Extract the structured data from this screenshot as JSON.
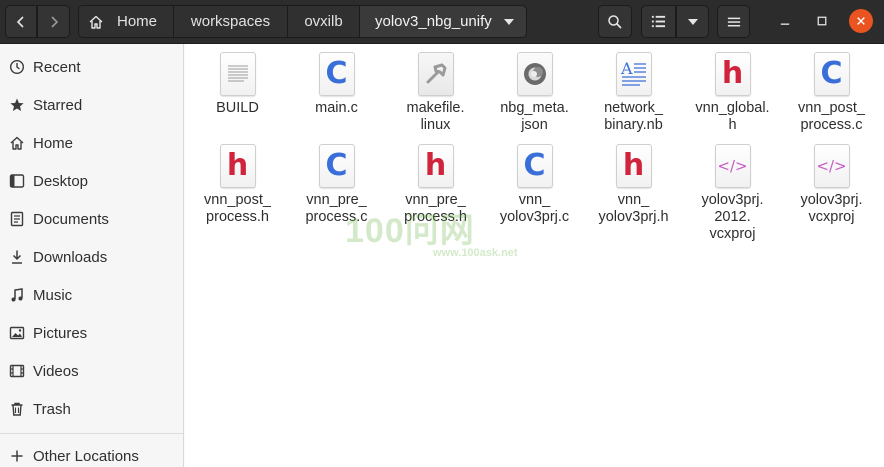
{
  "header": {
    "breadcrumbs": [
      "Home",
      "workspaces",
      "ovxilb",
      "yolov3_nbg_unify"
    ]
  },
  "sidebar": {
    "items": [
      {
        "label": "Recent",
        "icon": "clock-icon"
      },
      {
        "label": "Starred",
        "icon": "star-icon"
      },
      {
        "label": "Home",
        "icon": "home-icon"
      },
      {
        "label": "Desktop",
        "icon": "desktop-icon"
      },
      {
        "label": "Documents",
        "icon": "documents-icon"
      },
      {
        "label": "Downloads",
        "icon": "download-icon"
      },
      {
        "label": "Music",
        "icon": "music-icon"
      },
      {
        "label": "Pictures",
        "icon": "pictures-icon"
      },
      {
        "label": "Videos",
        "icon": "videos-icon"
      },
      {
        "label": "Trash",
        "icon": "trash-icon"
      }
    ],
    "other_locations": "Other Locations"
  },
  "files": [
    {
      "name": "BUILD",
      "type": "text"
    },
    {
      "name": "main.c",
      "type": "c"
    },
    {
      "name": "makefile.\nlinux",
      "type": "makefile"
    },
    {
      "name": "nbg_meta.\njson",
      "type": "json"
    },
    {
      "name": "network_\nbinary.nb",
      "type": "document"
    },
    {
      "name": "vnn_global.\nh",
      "type": "h"
    },
    {
      "name": "vnn_post_\nprocess.c",
      "type": "c"
    },
    {
      "name": "vnn_post_\nprocess.h",
      "type": "h"
    },
    {
      "name": "vnn_pre_\nprocess.c",
      "type": "c"
    },
    {
      "name": "vnn_pre_\nprocess.h",
      "type": "h"
    },
    {
      "name": "vnn_\nyolov3prj.c",
      "type": "c"
    },
    {
      "name": "vnn_\nyolov3prj.h",
      "type": "h"
    },
    {
      "name": "yolov3prj.\n2012.\nvcxproj",
      "type": "xml"
    },
    {
      "name": "yolov3prj.\nvcxproj",
      "type": "xml"
    }
  ],
  "icon_glyphs": {
    "c": "C",
    "h": "h",
    "xml": "</>",
    "document": "A"
  },
  "watermark": {
    "big": "100问网",
    "small": "www.100ask.net"
  },
  "colors": {
    "accent_close": "#e95420",
    "c_icon": "#3a6fd9",
    "h_icon": "#d0243c",
    "xml_icon": "#c75ac8"
  }
}
